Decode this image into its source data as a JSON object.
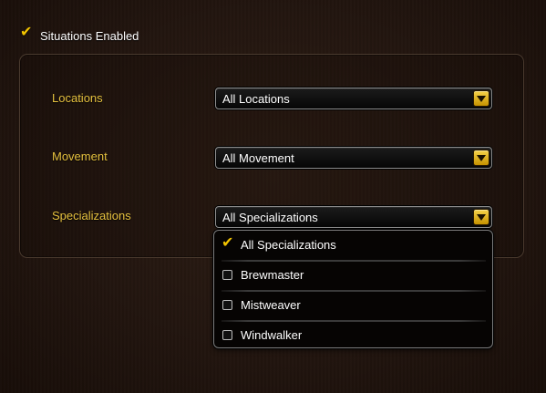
{
  "situations_toggle": {
    "label": "Situations Enabled",
    "checked": true,
    "icon": "checkmark-icon"
  },
  "filters": [
    {
      "label": "Locations",
      "value": "All Locations"
    },
    {
      "label": "Movement",
      "value": "All Movement"
    },
    {
      "label": "Specializations",
      "value": "All Specializations",
      "expanded": true
    }
  ],
  "specializations_menu": {
    "items": [
      {
        "label": "All Specializations",
        "checked": true
      },
      {
        "label": "Brewmaster",
        "checked": false
      },
      {
        "label": "Mistweaver",
        "checked": false
      },
      {
        "label": "Windwalker",
        "checked": false
      }
    ]
  },
  "colors": {
    "accent_gold": "#e6c13f",
    "check_yellow": "#f2c300",
    "background": "#22150f"
  }
}
